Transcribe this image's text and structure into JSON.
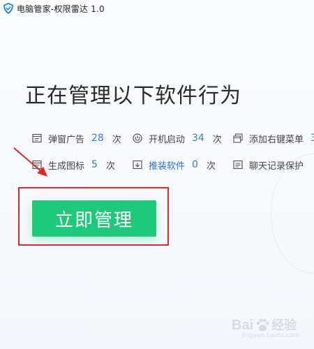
{
  "window": {
    "title": "电脑管家-权限雷达 1.0"
  },
  "main": {
    "heading": "正在管理以下软件行为",
    "stats_row1": [
      {
        "label": "弹窗广告",
        "count": "28",
        "unit": "次"
      },
      {
        "label": "开机启动",
        "count": "34",
        "unit": "次"
      },
      {
        "label": "添加右键菜单",
        "count": "3",
        "unit": ""
      }
    ],
    "stats_row2": [
      {
        "label": "生成图标",
        "count": "5",
        "unit": "次"
      },
      {
        "label": "推装软件",
        "count": "0",
        "unit": "次"
      },
      {
        "label": "聊天记录保护",
        "count": "",
        "unit": ""
      }
    ],
    "manage_button_label": "立即管理"
  },
  "watermark": {
    "brand_left": "Bai",
    "brand_right": "经验",
    "url": "jingyan.baidu.com"
  },
  "colors": {
    "accent_green": "#1fc97b",
    "count_blue": "#2f7fd6",
    "link_blue": "#2f6fd0",
    "annotation_red": "#e0262a",
    "logo_blue": "#1a8be8"
  },
  "icons": {
    "logo": "tencent-shield-icon",
    "popup_ads": "window-icon",
    "startup": "power-icon",
    "context_menu": "stacked-windows-icon",
    "create_icon": "window-icon",
    "bundled_install": "download-box-icon",
    "chat_history": "chat-window-icon"
  }
}
